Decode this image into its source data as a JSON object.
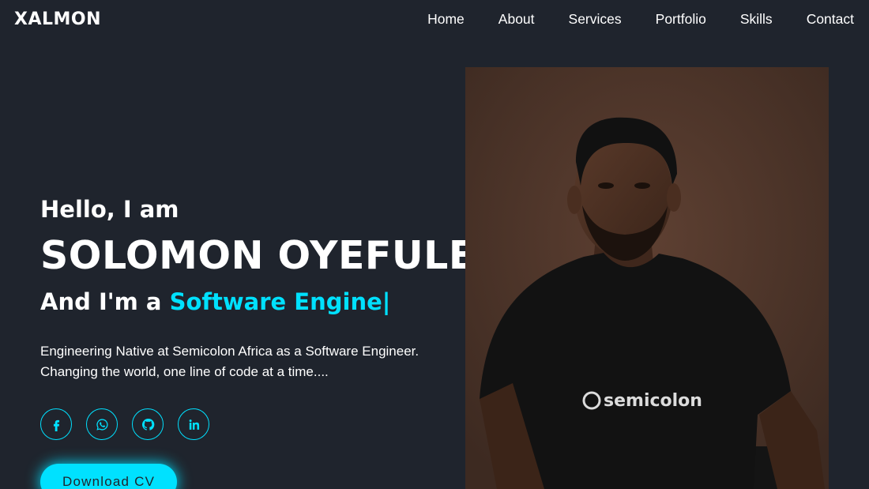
{
  "header": {
    "logo": "XALMON",
    "nav": [
      "Home",
      "About",
      "Services",
      "Portfolio",
      "Skills",
      "Contact"
    ]
  },
  "hero": {
    "greeting": "Hello, I am",
    "name": "SOLOMON OYEFULE",
    "role_prefix": "And I'm a ",
    "role_typed": "Software Engine",
    "cursor": "|",
    "description_line1": "Engineering Native at Semicolon Africa as a Software Engineer.",
    "description_line2": "Changing the world, one line of code at a time....",
    "socials": [
      {
        "icon": "facebook-icon"
      },
      {
        "icon": "whatsapp-icon"
      },
      {
        "icon": "github-icon"
      },
      {
        "icon": "linkedin-icon"
      }
    ],
    "cta_label": "Download CV"
  },
  "photo": {
    "shirt_text": "semicolon"
  },
  "colors": {
    "background": "#1f242d",
    "accent": "#00e1ff",
    "text": "#ffffff"
  }
}
